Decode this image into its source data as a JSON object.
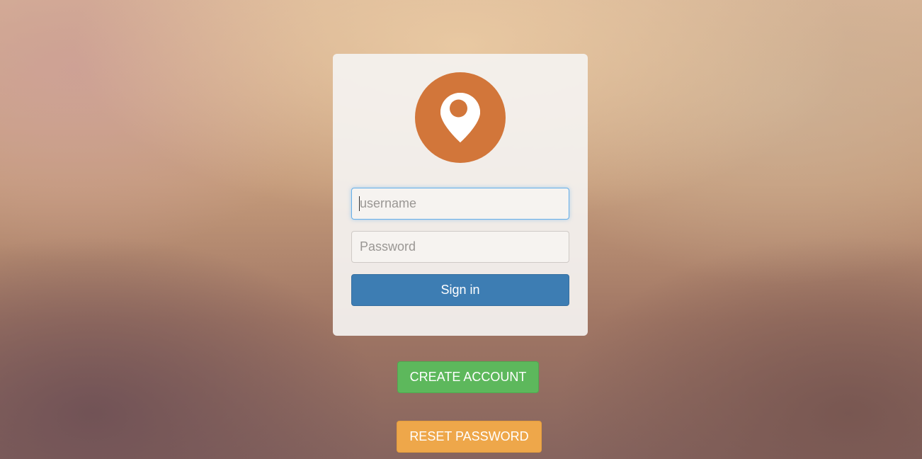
{
  "login_card": {
    "logo_icon": "map-marker-icon",
    "username_placeholder": "username",
    "password_placeholder": "Password",
    "signin_label": "Sign in"
  },
  "actions": {
    "create_account_label": "CREATE ACCOUNT",
    "reset_password_label": "RESET PASSWORD"
  },
  "colors": {
    "logo_bg": "#d2763a",
    "signin": "#3d7db3",
    "create_account": "#5db85c",
    "reset_password": "#eea74a",
    "focus_ring": "#66afe9"
  }
}
